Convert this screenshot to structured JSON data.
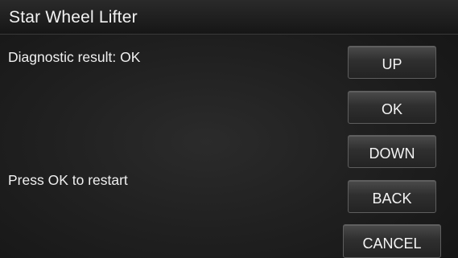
{
  "header": {
    "title": "Star Wheel Lifter"
  },
  "main": {
    "result_text": "Diagnostic result: OK",
    "prompt_text": "Press OK to restart"
  },
  "buttons": {
    "up": "UP",
    "ok": "OK",
    "down": "DOWN",
    "back": "BACK",
    "cancel": "CANCEL"
  }
}
